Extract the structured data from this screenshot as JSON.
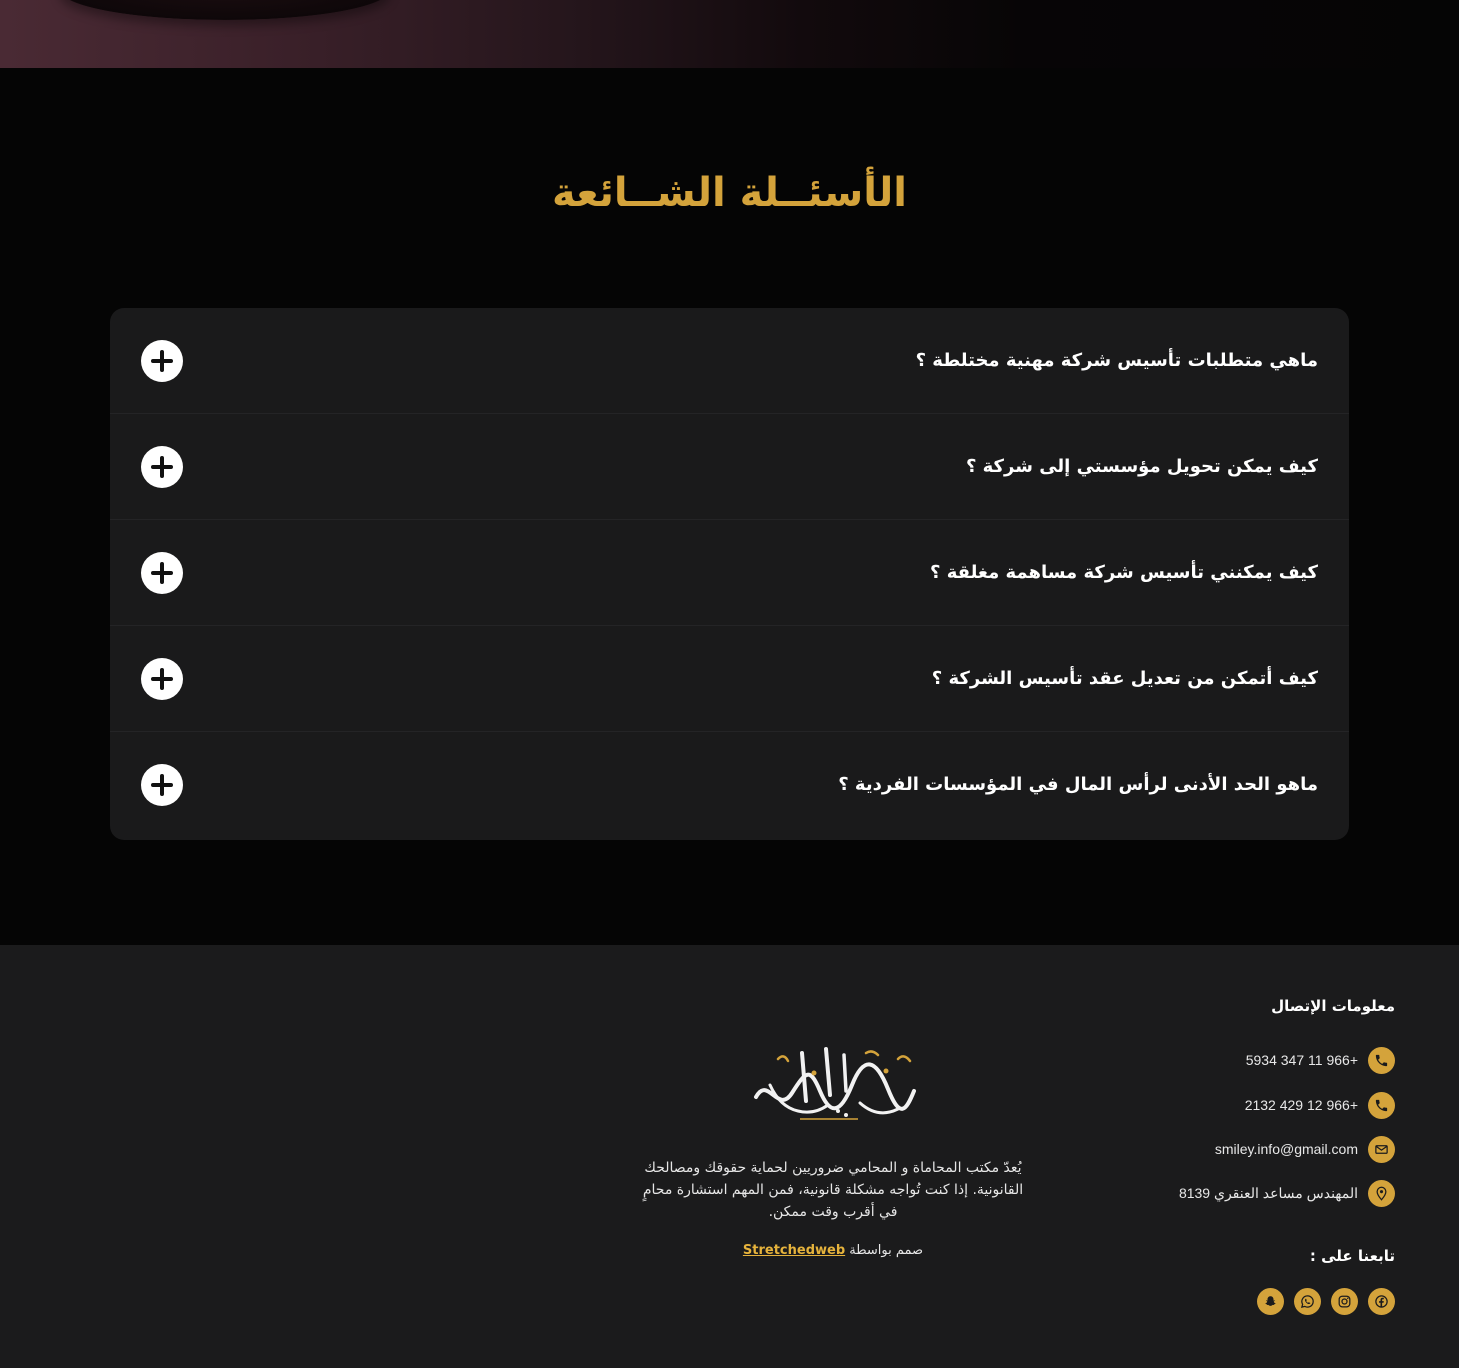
{
  "faq": {
    "title": "الأسئــلة الشــائعة",
    "items": [
      {
        "question": "ماهي متطلبات تأسيس شركة مهنية مختلطة ؟"
      },
      {
        "question": "كيف يمكن تحويل مؤسستي إلى شركة ؟"
      },
      {
        "question": "كيف يمكنني تأسيس شركة مساهمة مغلقة ؟"
      },
      {
        "question": "كيف أتمكن من تعديل عقد تأسيس الشركة ؟"
      },
      {
        "question": "ماهو الحد الأدنى لرأس المال في المؤسسات الفردية ؟"
      }
    ],
    "toggle_icon": "plus-icon"
  },
  "footer": {
    "contact_heading": "معلومات الإتصال",
    "contacts": [
      {
        "icon": "phone-icon",
        "text": "+966 11 347 5934"
      },
      {
        "icon": "phone-icon",
        "text": "+966 12 429 2132"
      },
      {
        "icon": "mail-icon",
        "text": "smiley.info@gmail.com"
      },
      {
        "icon": "location-pin-icon",
        "text": "المهندس مساعد العنقري 8139"
      }
    ],
    "follow_heading": "تابعنا على :",
    "socials": [
      {
        "icon": "facebook-icon"
      },
      {
        "icon": "instagram-icon"
      },
      {
        "icon": "whatsapp-icon"
      },
      {
        "icon": "snapchat-icon"
      }
    ],
    "logo_icon": "calligraphy-logo",
    "about_text": "يُعدّ مكتب المحاماة و المحامي ضروريين لحماية حقوقك ومصالحك القانونية. إذا كنت تُواجه مشكلة قانونية، فمن المهم استشارة محامٍ في أقرب وقت ممكن.",
    "credit_prefix": "صمم بواسطة",
    "credit_link": "Stretchedweb"
  },
  "colors": {
    "accent": "#d4a33b",
    "background": "#050505",
    "panel": "#1a1a1b"
  }
}
